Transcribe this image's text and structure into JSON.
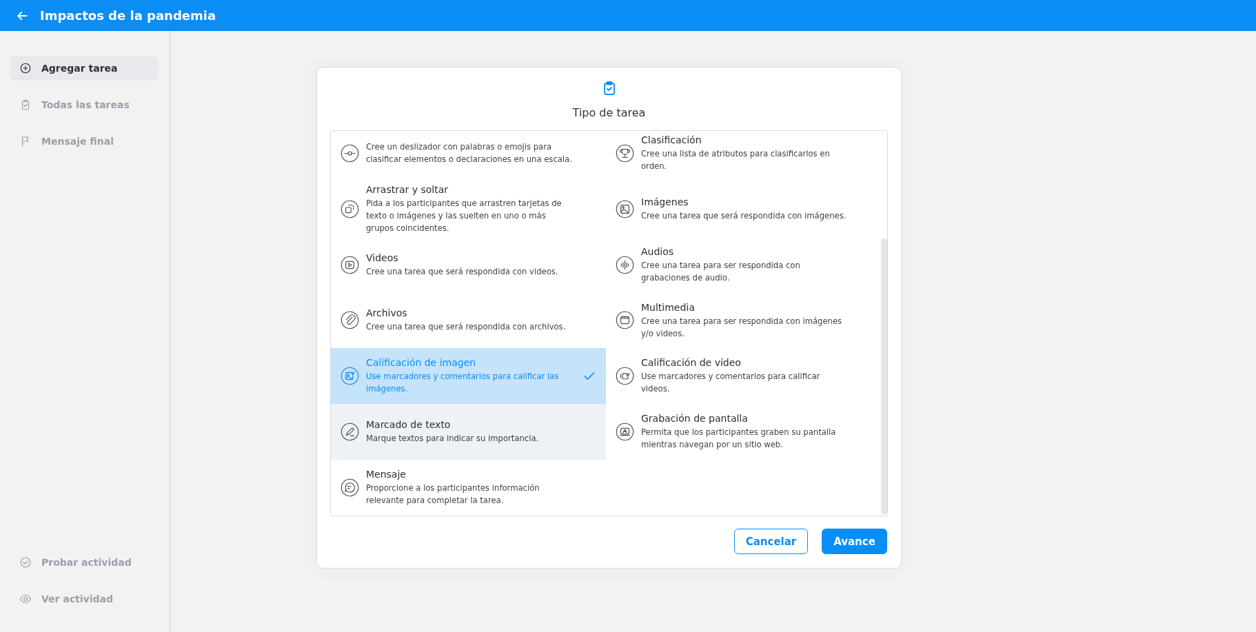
{
  "header": {
    "title": "Impactos de la pandemia"
  },
  "sidebar": {
    "items": [
      {
        "label": "Agregar tarea",
        "kind": "plus",
        "selected": true
      },
      {
        "label": "Todas las tareas",
        "kind": "clipboard",
        "selected": false
      },
      {
        "label": "Mensaje final",
        "kind": "flag",
        "selected": false
      }
    ],
    "footer_items": [
      {
        "label": "Probar actividad",
        "kind": "check-circle"
      },
      {
        "label": "Ver actividad",
        "kind": "eye"
      }
    ]
  },
  "modal": {
    "title": "Tipo de tarea",
    "rows": [
      [
        {
          "kind": "slider",
          "description": "Cree un deslizador con palabras o emojis para clasificar elementos o declaraciones en una escala.",
          "selected": false,
          "hovered": false
        },
        {
          "kind": "trophy",
          "title": "Clasificación",
          "description": "Cree una lista de atributos para clasificarlos en orden.",
          "selected": false,
          "hovered": false
        }
      ],
      [
        {
          "kind": "drag",
          "title": "Arrastrar y soltar",
          "description": "Pida a los participantes que arrastren tarjetas de texto o imágenes y las suelten en uno o más grupos coincidentes.",
          "selected": false,
          "hovered": false
        },
        {
          "kind": "image",
          "title": "Imágenes",
          "description": "Cree una tarea que será respondida con imágenes.",
          "selected": false,
          "hovered": false
        }
      ],
      [
        {
          "kind": "video",
          "title": "Videos",
          "description": "Cree una tarea que será respondida con videos.",
          "selected": false,
          "hovered": false
        },
        {
          "kind": "audio",
          "title": "Audios",
          "description": "Cree una tarea para ser respondida con grabaciones de audio.",
          "selected": false,
          "hovered": false
        }
      ],
      [
        {
          "kind": "files",
          "title": "Archivos",
          "description": "Cree una tarea que será respondida con archivos.",
          "selected": false,
          "hovered": false
        },
        {
          "kind": "multimedia",
          "title": "Multimedia",
          "description": "Cree una tarea para ser respondida con imágenes y/o videos.",
          "selected": false,
          "hovered": false
        }
      ],
      [
        {
          "kind": "image-rating",
          "title": "Calificación de imagen",
          "description": "Use marcadores y comentarios para calificar las imágenes.",
          "selected": true,
          "hovered": false
        },
        {
          "kind": "video-rating",
          "title": "Calificación de vídeo",
          "description": "Use marcadores y comentarios para calificar videos.",
          "selected": false,
          "hovered": false
        }
      ],
      [
        {
          "kind": "pencil",
          "title": "Marcado de texto",
          "description": "Marque textos para indicar su importancia.",
          "selected": false,
          "hovered": true
        },
        {
          "kind": "screen",
          "title": "Grabación de pantalla",
          "description": "Permita que los participantes graben su pantalla mientras navegan por un sitio web.",
          "selected": false,
          "hovered": false
        }
      ],
      [
        {
          "kind": "message",
          "title": "Mensaje",
          "description": "Proporcione a los participantes información relevante para completar la tarea.",
          "selected": false,
          "hovered": false
        }
      ]
    ],
    "buttons": [
      {
        "label": "Cancelar",
        "kind": "secondary"
      },
      {
        "label": "Avance",
        "kind": "primary"
      }
    ]
  }
}
